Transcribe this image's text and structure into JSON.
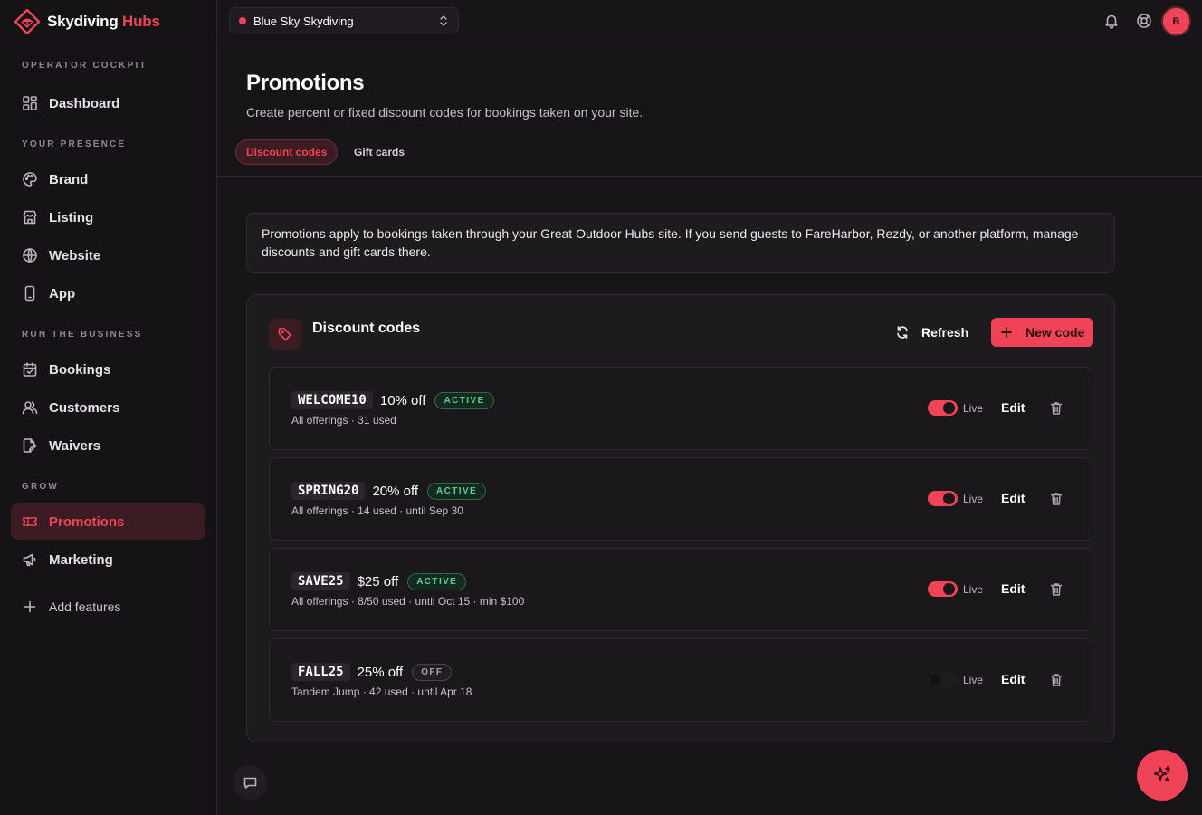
{
  "brand": {
    "name_main": "Skydiving",
    "name_accent": "Hubs",
    "accent_color": "#ef4457"
  },
  "topbar": {
    "site_name": "Blue Sky Skydiving",
    "notification_icon": "bell-icon",
    "help_icon": "lifebuoy-icon",
    "avatar_initial": "B"
  },
  "sidebar": {
    "sections": [
      {
        "label": "OPERATOR COCKPIT",
        "items": [
          {
            "label": "Dashboard",
            "icon": "dashboard-icon"
          }
        ]
      },
      {
        "label": "YOUR PRESENCE",
        "items": [
          {
            "label": "Brand",
            "icon": "palette-icon"
          },
          {
            "label": "Listing",
            "icon": "store-icon"
          },
          {
            "label": "Website",
            "icon": "globe-icon"
          },
          {
            "label": "App",
            "icon": "phone-icon"
          }
        ]
      },
      {
        "label": "RUN THE BUSINESS",
        "items": [
          {
            "label": "Bookings",
            "icon": "calendar-icon"
          },
          {
            "label": "Customers",
            "icon": "users-icon"
          },
          {
            "label": "Waivers",
            "icon": "document-edit-icon"
          }
        ]
      },
      {
        "label": "GROW",
        "items": [
          {
            "label": "Promotions",
            "icon": "ticket-icon",
            "active": true
          },
          {
            "label": "Marketing",
            "icon": "megaphone-icon"
          }
        ]
      }
    ],
    "add_features": "Add features"
  },
  "page": {
    "title": "Promotions",
    "subtitle": "Create percent or fixed discount codes for bookings taken on your site.",
    "tabs": [
      {
        "label": "Discount codes",
        "active": true
      },
      {
        "label": "Gift cards",
        "active": false
      }
    ]
  },
  "notice": {
    "text": "Promotions apply to bookings taken through your Great Outdoor Hubs site. If you send guests to FareHarbor, Rezdy, or another platform, manage discounts and gift cards there."
  },
  "discount_card": {
    "title": "Discount codes",
    "refresh_label": "Refresh",
    "new_code_label": "New code",
    "codes": [
      {
        "code": "WELCOME10",
        "amount": "10% off",
        "status": "ACTIVE",
        "meta": "All offerings · 31 used",
        "live": true,
        "live_label": "Live",
        "edit_label": "Edit"
      },
      {
        "code": "SPRING20",
        "amount": "20% off",
        "status": "ACTIVE",
        "meta": "All offerings · 14 used · until Sep 30",
        "live": true,
        "live_label": "Live",
        "edit_label": "Edit"
      },
      {
        "code": "SAVE25",
        "amount": "$25 off",
        "status": "ACTIVE",
        "meta": "All offerings · 8/50 used · until Oct 15 · min $100",
        "live": true,
        "live_label": "Live",
        "edit_label": "Edit"
      },
      {
        "code": "FALL25",
        "amount": "25% off",
        "status": "OFF",
        "meta": "Tandem Jump · 42 used · until Apr 18",
        "live": false,
        "live_label": "Live",
        "edit_label": "Edit"
      }
    ]
  },
  "floating": {
    "chat_icon": "chat-icon",
    "assistant_icon": "sparkles-icon"
  }
}
